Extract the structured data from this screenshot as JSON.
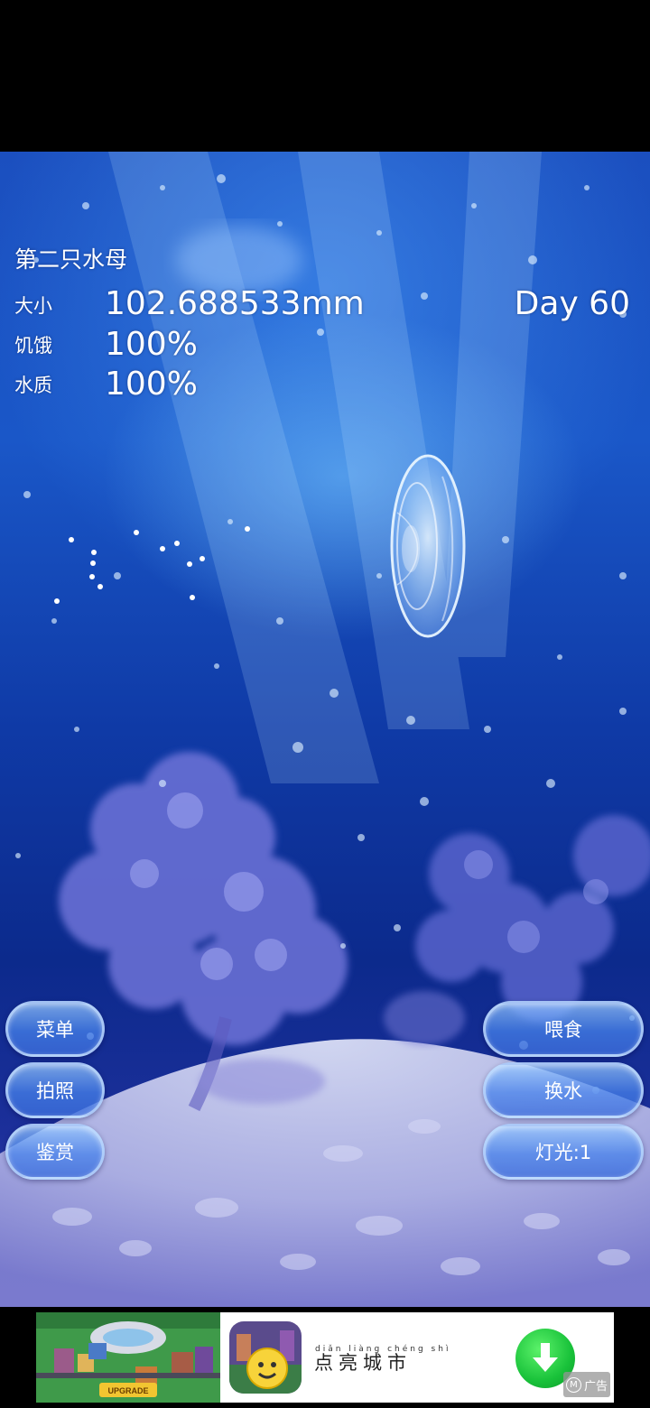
{
  "hud": {
    "jellyfish_name": "第二只水母",
    "stats": {
      "size_label": "大小",
      "size_value": "102.688533mm",
      "hunger_label": "饥饿",
      "hunger_value": "100%",
      "water_label": "水质",
      "water_value": "100%"
    },
    "day": "Day 60"
  },
  "buttons": {
    "menu": "菜单",
    "photo": "拍照",
    "appreciate": "鉴赏",
    "feed": "喂食",
    "change_water": "换水",
    "light": "灯光:1"
  },
  "ad": {
    "image_caption": "UPGRADE",
    "pinyin": "diǎn liàng chéng shì",
    "title": "点亮城市",
    "badge_text": "广告",
    "badge_mark": "M"
  },
  "colors": {
    "water_top": "#1b4fbf",
    "water_deep": "#0c2a8c",
    "sand": "#c9cdf2",
    "download_green": "#19c23a"
  }
}
